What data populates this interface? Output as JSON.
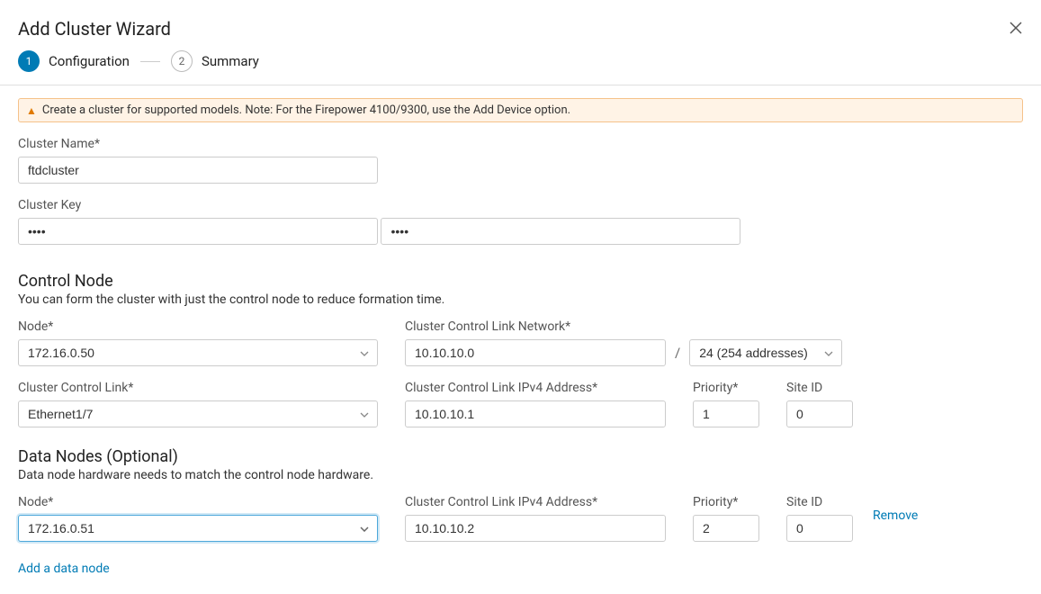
{
  "wizard": {
    "title": "Add Cluster Wizard",
    "steps": [
      {
        "number": "1",
        "label": "Configuration",
        "active": true
      },
      {
        "number": "2",
        "label": "Summary",
        "active": false
      }
    ],
    "alert": "Create a cluster for supported models. Note: For the Firepower 4100/9300, use the Add Device option."
  },
  "cluster": {
    "name_label": "Cluster Name*",
    "name_value": "ftdcluster",
    "key_label": "Cluster Key",
    "key_value1": "••••",
    "key_value2": "••••"
  },
  "control_node": {
    "title": "Control Node",
    "desc": "You can form the cluster with just the control node to reduce formation time.",
    "node_label": "Node*",
    "node_value": "172.16.0.50",
    "ccl_network_label": "Cluster Control Link Network*",
    "ccl_network_value": "10.10.10.0",
    "subnet_value": "24 (254 addresses)",
    "ccl_link_label": "Cluster Control Link*",
    "ccl_link_value": "Ethernet1/7",
    "ccl_ipv4_label": "Cluster Control Link IPv4 Address*",
    "ccl_ipv4_value": "10.10.10.1",
    "priority_label": "Priority*",
    "priority_value": "1",
    "siteid_label": "Site ID",
    "siteid_value": "0"
  },
  "data_nodes": {
    "title": "Data Nodes (Optional)",
    "desc": "Data node hardware needs to match the control node hardware.",
    "node_label": "Node*",
    "node_value": "172.16.0.51",
    "ccl_ipv4_label": "Cluster Control Link IPv4 Address*",
    "ccl_ipv4_value": "10.10.10.2",
    "priority_label": "Priority*",
    "priority_value": "2",
    "siteid_label": "Site ID",
    "siteid_value": "0",
    "remove_label": "Remove",
    "add_label": "Add a data node"
  }
}
